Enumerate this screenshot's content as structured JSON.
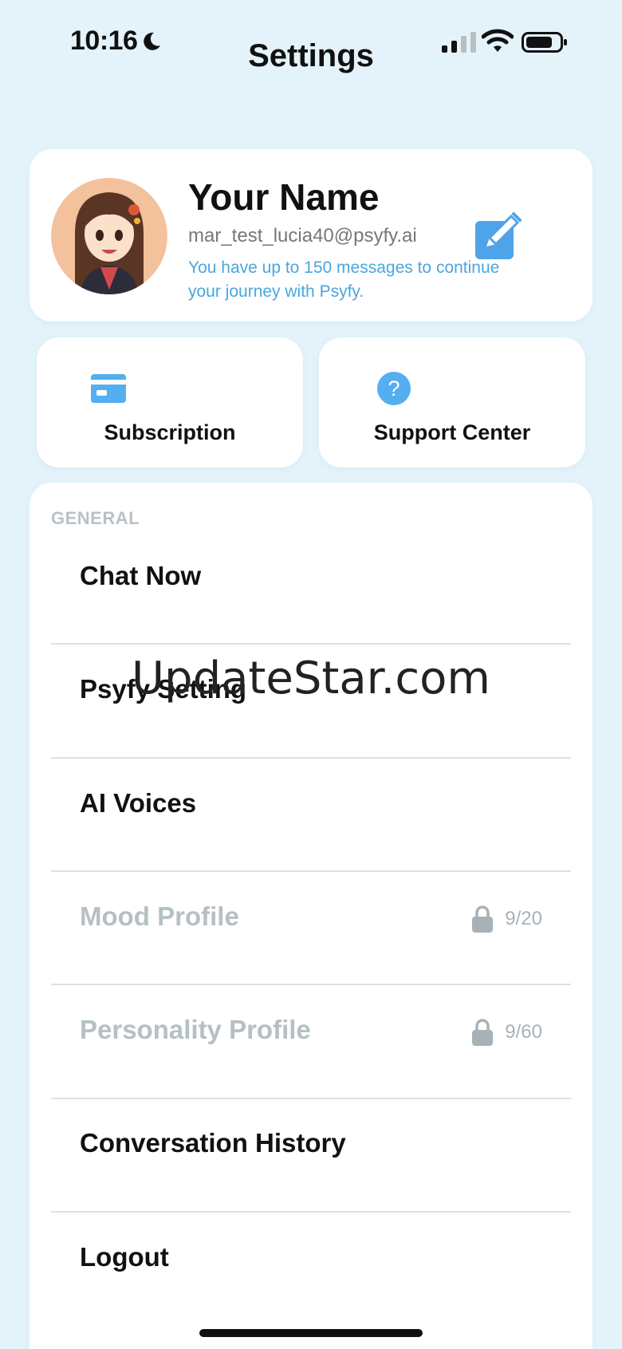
{
  "status_bar": {
    "time": "10:16"
  },
  "header": {
    "title": "Settings"
  },
  "profile": {
    "name": "Your Name",
    "email": "mar_test_lucia40@psyfy.ai",
    "message_info": "You have up to 150 messages to continue your journey with Psyfy."
  },
  "tiles": {
    "subscription": {
      "label": "Subscription",
      "icon": "credit-card-icon"
    },
    "support": {
      "label": "Support Center",
      "icon": "question-icon",
      "glyph": "?"
    }
  },
  "menu": {
    "section_label": "GENERAL",
    "items": [
      {
        "label": "Chat Now"
      },
      {
        "label": "Psyfy Setting"
      },
      {
        "label": "AI Voices"
      },
      {
        "label": "Mood Profile",
        "locked": true,
        "count": "9/20"
      },
      {
        "label": "Personality Profile",
        "locked": true,
        "count": "9/60"
      },
      {
        "label": "Conversation History"
      },
      {
        "label": "Logout"
      }
    ]
  },
  "watermark": "UpdateStar.com",
  "colors": {
    "background": "#e4f3fa",
    "accent": "#4aa6de",
    "icon_blue": "#55aef0",
    "muted": "#b5c0c4"
  }
}
